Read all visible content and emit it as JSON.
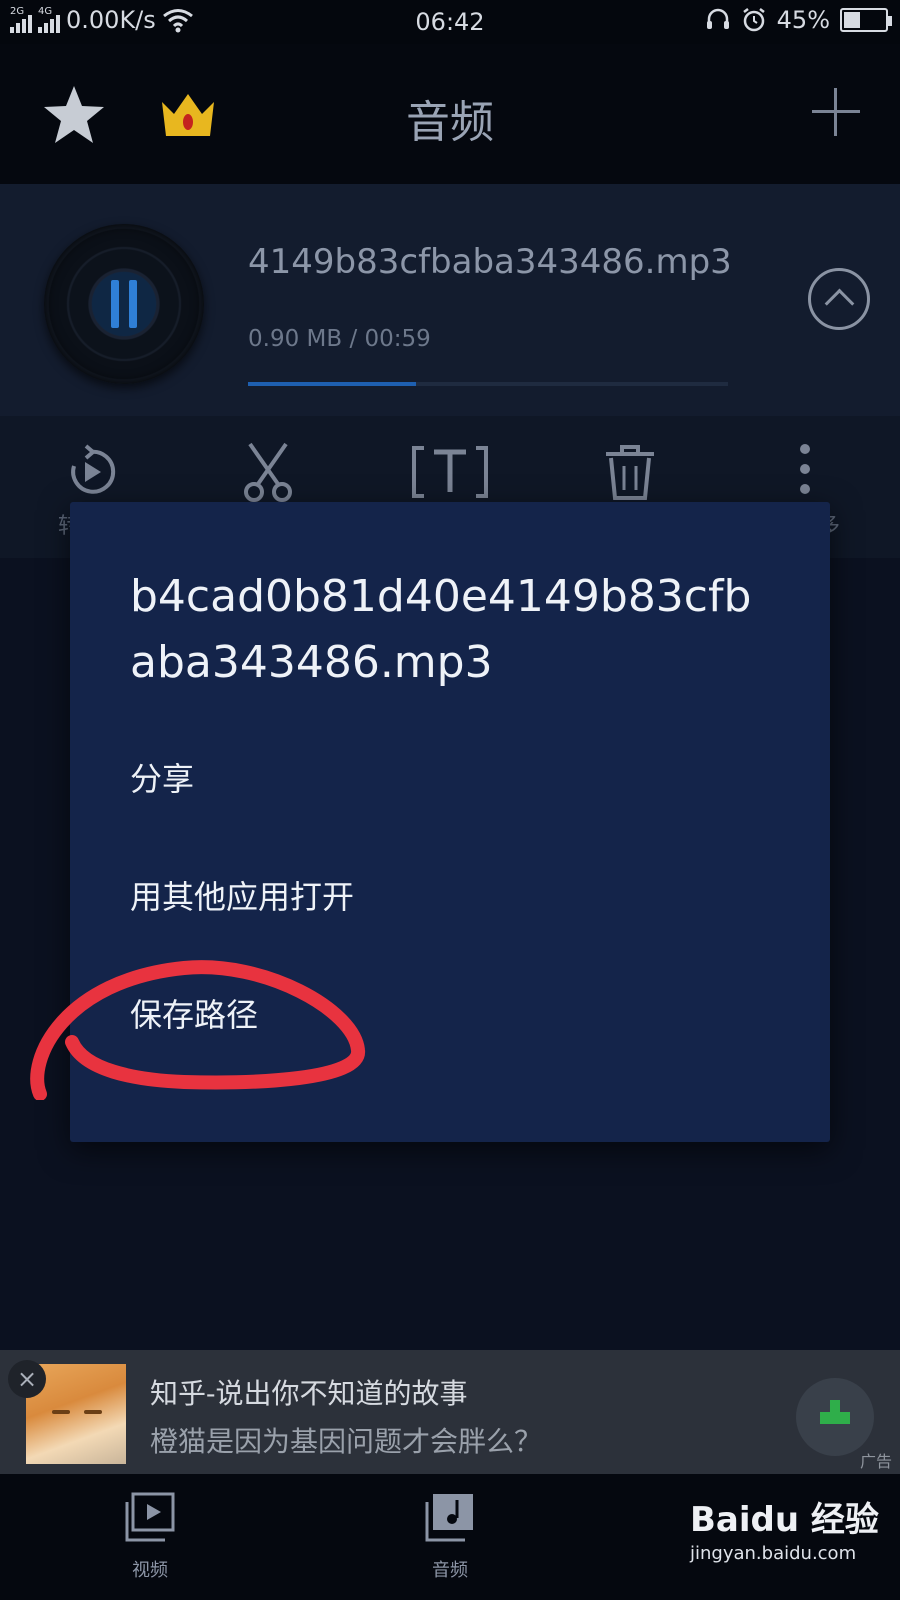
{
  "status_bar": {
    "net1": "2G",
    "net2": "4G",
    "speed": "0.00K/s",
    "time": "06:42",
    "battery_percent": "45%",
    "battery_level": 0.45
  },
  "header": {
    "title": "音频"
  },
  "player": {
    "track_name": "4149b83cfbaba343486.mp3",
    "meta": "0.90 MB / 00:59",
    "progress": 0.35
  },
  "toolbar": {
    "left_label": "转",
    "right_label": "多"
  },
  "dialog": {
    "title": "b4cad0b81d40e4149b83cfbaba343486.mp3",
    "items": [
      "分享",
      "用其他应用打开",
      "保存路径"
    ]
  },
  "ad": {
    "close": "×",
    "title": "知乎-说出你不知道的故事",
    "subtitle": "橙猫是因为基因问题才会胖么？",
    "tag": "广告"
  },
  "bottom_nav": {
    "items": [
      {
        "label": "视频"
      },
      {
        "label": "音频"
      }
    ]
  },
  "watermark": {
    "brand": "Baidu 经验",
    "url": "jingyan.baidu.com"
  },
  "colors": {
    "accent": "#1e5fb0",
    "dialog_bg": "#14244a",
    "annotation": "#e8333f"
  }
}
